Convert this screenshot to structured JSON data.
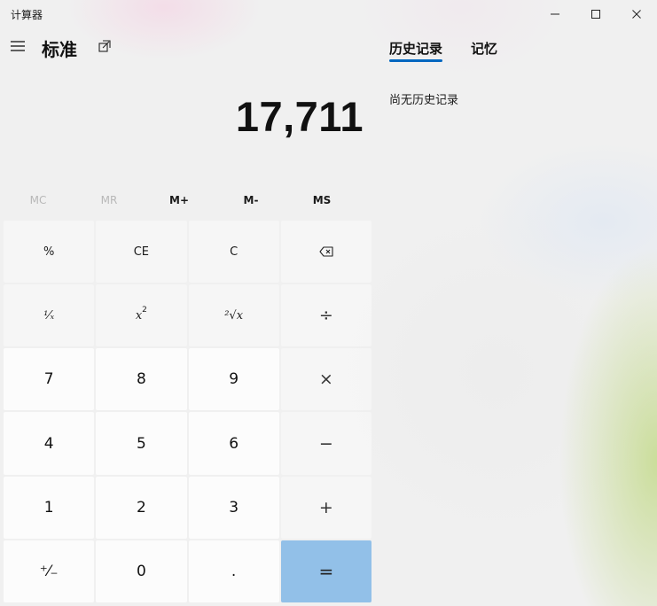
{
  "window": {
    "title": "计算器",
    "controls": [
      "minimize-icon",
      "maximize-icon",
      "close-icon"
    ]
  },
  "header": {
    "menu_icon": "hamburger-menu-icon",
    "mode": "标准",
    "keep_on_top_icon": "keep-on-top-icon"
  },
  "side_panel": {
    "tabs": [
      {
        "label": "历史记录",
        "active": true
      },
      {
        "label": "记忆",
        "active": false
      }
    ],
    "empty_text": "尚无历史记录",
    "accent_color": "#0067c0"
  },
  "display": {
    "value": "17,711"
  },
  "memory": {
    "buttons": [
      {
        "label": "MC",
        "enabled": false
      },
      {
        "label": "MR",
        "enabled": false
      },
      {
        "label": "M+",
        "enabled": true
      },
      {
        "label": "M-",
        "enabled": true
      },
      {
        "label": "MS",
        "enabled": true
      }
    ]
  },
  "keys": {
    "percent": "%",
    "clear_entry": "CE",
    "clear": "C",
    "backspace_icon": "backspace-icon",
    "reciprocal": "¹⁄ₓ",
    "square_base": "x",
    "square_exp": "2",
    "sqrt": "²√x",
    "divide": "÷",
    "seven": "7",
    "eight": "8",
    "nine": "9",
    "multiply": "×",
    "four": "4",
    "five": "5",
    "six": "6",
    "minus": "−",
    "one": "1",
    "two": "2",
    "three": "3",
    "plus": "+",
    "negate": "⁺⁄₋",
    "zero": "0",
    "decimal": ".",
    "equals": "=",
    "equals_color": "#92c0e8"
  }
}
